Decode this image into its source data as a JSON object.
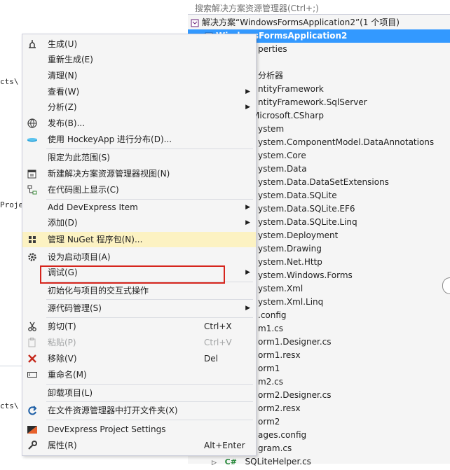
{
  "editor": {
    "fragments": [
      "cts\\",
      "Proje",
      "cts\\"
    ]
  },
  "explorer": {
    "search_placeholder": "搜索解决方案资源管理器(Ctrl+;)",
    "solution_label": "解决方案“WindowsFormsApplication2”(1 个项目)",
    "project_label": "WindowsFormsApplication2",
    "items": [
      "perties",
      "分析器",
      "ntityFramework",
      "ntityFramework.SqlServer",
      "Microsoft.CSharp",
      "ystem",
      "ystem.ComponentModel.DataAnnotations",
      "ystem.Core",
      "ystem.Data",
      "ystem.Data.DataSetExtensions",
      "ystem.Data.SQLite",
      "ystem.Data.SQLite.EF6",
      "ystem.Data.SQLite.Linq",
      "ystem.Deployment",
      "ystem.Drawing",
      "ystem.Net.Http",
      "ystem.Windows.Forms",
      "ystem.Xml",
      "ystem.Xml.Linq",
      ".config",
      "m1.cs",
      "orm1.Designer.cs",
      "orm1.resx",
      "orm1",
      "m2.cs",
      "orm2.Designer.cs",
      "orm2.resx",
      "orm2",
      "ages.config",
      "gram.cs",
      "SQLiteHelper.cs"
    ],
    "last_item_prefix": "C#"
  },
  "menu": {
    "items": {
      "build": {
        "label": "生成(U)",
        "icon": "build-icon"
      },
      "rebuild": {
        "label": "重新生成(E)"
      },
      "clean": {
        "label": "清理(N)"
      },
      "view": {
        "label": "查看(W)",
        "arrow": "▶"
      },
      "analyze": {
        "label": "分析(Z)",
        "arrow": "▶"
      },
      "publish": {
        "label": "发布(B)...",
        "icon": "globe-icon"
      },
      "hockeyapp": {
        "label": "使用 HockeyApp 进行分布(D)...",
        "icon": "hockeyapp-icon"
      },
      "scope": {
        "label": "限定为此范围(S)"
      },
      "new_view": {
        "label": "新建解决方案资源管理器视图(N)",
        "icon": "new-window-icon"
      },
      "code_map": {
        "label": "在代码图上显示(C)",
        "icon": "code-map-icon"
      },
      "devexpress_item": {
        "label": "Add DevExpress Item",
        "arrow": "▶"
      },
      "add": {
        "label": "添加(D)",
        "arrow": "▶"
      },
      "nuget": {
        "label": "管理 NuGet 程序包(N)...",
        "icon": "nuget-icon"
      },
      "startup": {
        "label": "设为启动项目(A)",
        "icon": "gear-icon"
      },
      "debug": {
        "label": "调试(G)",
        "arrow": "▶"
      },
      "interactive": {
        "label": "初始化与项目的交互式操作"
      },
      "source_control": {
        "label": "源代码管理(S)",
        "arrow": "▶"
      },
      "cut": {
        "label": "剪切(T)",
        "shortcut": "Ctrl+X",
        "icon": "scissors-icon"
      },
      "paste": {
        "label": "粘贴(P)",
        "shortcut": "Ctrl+V",
        "icon": "paste-icon"
      },
      "remove": {
        "label": "移除(V)",
        "shortcut": "Del",
        "icon": "delete-icon"
      },
      "rename": {
        "label": "重命名(M)",
        "icon": "rename-icon"
      },
      "unload": {
        "label": "卸载项目(L)"
      },
      "open_folder": {
        "label": "在文件资源管理器中打开文件夹(X)",
        "icon": "open-folder-icon"
      },
      "dx_settings": {
        "label": "DevExpress Project Settings",
        "icon": "devexpress-icon"
      },
      "properties": {
        "label": "属性(R)",
        "shortcut": "Alt+Enter",
        "icon": "wrench-icon"
      }
    }
  },
  "colors": {
    "selection": "#3399ff",
    "hover": "#fcf2c2",
    "highlight_border": "#d6251d"
  }
}
